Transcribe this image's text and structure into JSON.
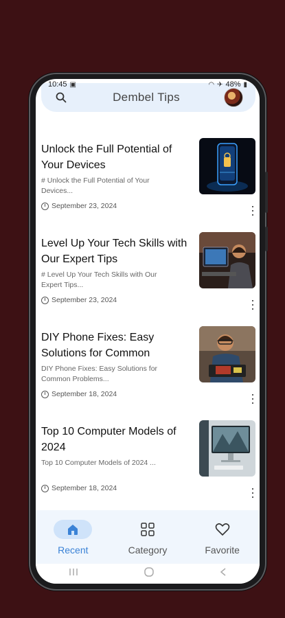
{
  "status_bar": {
    "time": "10:45",
    "battery": "48%"
  },
  "app": {
    "title": "Dembel Tips"
  },
  "posts": [
    {
      "title": "Unlock the Full Potential of Your Devices",
      "excerpt": "# Unlock the Full Potential of Your Devices...",
      "date": "September 23, 2024",
      "thumbnail": "glowing-smartphone-image"
    },
    {
      "title": "Level Up Your Tech Skills with Our Expert Tips",
      "excerpt": "# Level Up Your Tech Skills with Our Expert Tips...",
      "date": "September 23, 2024",
      "thumbnail": "man-at-computer-image"
    },
    {
      "title": "DIY Phone Fixes: Easy Solutions for Common",
      "excerpt": "DIY Phone Fixes: Easy Solutions for Common Problems...",
      "date": "September 18, 2024",
      "thumbnail": "man-repairing-phone-image"
    },
    {
      "title": "Top 10 Computer Models of 2024",
      "excerpt": "Top 10 Computer Models of 2024 ...",
      "date": "September 18, 2024",
      "thumbnail": "desktop-computer-image"
    }
  ],
  "bottom_nav": {
    "items": [
      {
        "label": "Recent",
        "icon": "home-icon",
        "active": true
      },
      {
        "label": "Category",
        "icon": "grid-icon",
        "active": false
      },
      {
        "label": "Favorite",
        "icon": "heart-icon",
        "active": false
      }
    ]
  },
  "colors": {
    "background": "#3d1114",
    "accent": "#3a82d6",
    "search_bar": "#e7f0fb",
    "nav_bar": "#f0f6fd"
  }
}
